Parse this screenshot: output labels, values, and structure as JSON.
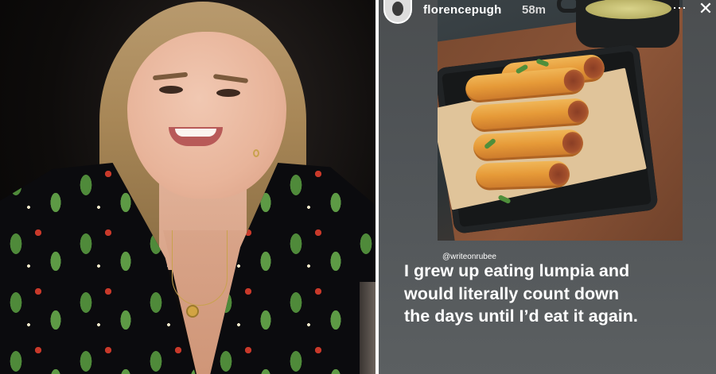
{
  "left_photo": {
    "alt_subject": "woman-in-patterned-blazer"
  },
  "story": {
    "username": "florencepugh",
    "time_ago": "58m",
    "more_icon": "ellipsis-icon",
    "close_icon": "close-icon",
    "food_photo": {
      "subject": "lumpia-rolls-on-tray"
    },
    "mention": "@writeonrubee",
    "caption": "I grew up eating lumpia and would literally count down the days until I’d eat it again."
  },
  "colors": {
    "story_background": "#505457",
    "text": "#ffffff",
    "roll": "#e69a38"
  }
}
